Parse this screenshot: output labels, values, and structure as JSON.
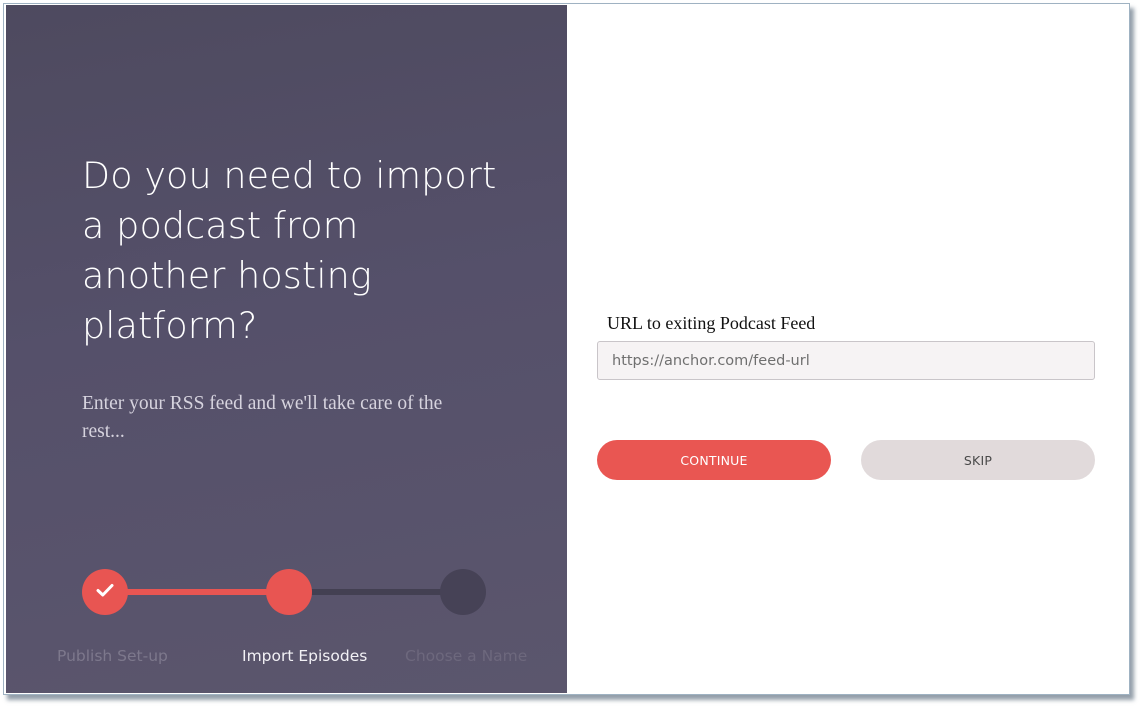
{
  "left": {
    "headline": "Do you need to import a podcast from another hosting platform?",
    "subtext": "Enter your RSS feed and we'll take care of the rest..."
  },
  "stepper": {
    "steps": [
      {
        "label": "Publish Set-up",
        "status": "completed",
        "icon": "check-icon"
      },
      {
        "label": "Import Episodes",
        "status": "current"
      },
      {
        "label": "Choose a Name",
        "status": "upcoming"
      }
    ]
  },
  "form": {
    "url_label": "URL to exiting Podcast Feed",
    "url_placeholder": "https://anchor.com/feed-url",
    "url_value": ""
  },
  "buttons": {
    "continue_label": "CONTINUE",
    "skip_label": "SKIP"
  },
  "colors": {
    "accent": "#e95652",
    "panel_dark": "#524e65",
    "skip_bg": "#e1dadb",
    "step_inactive": "#464256"
  }
}
